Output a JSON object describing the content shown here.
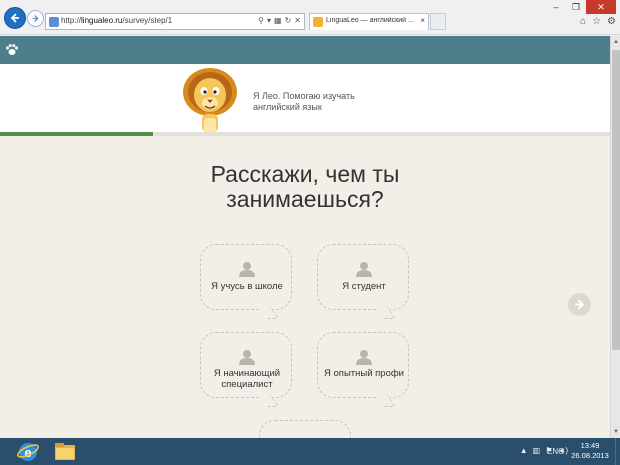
{
  "browser": {
    "url_prefix": "http://",
    "url_host": "lingualeo.ru",
    "url_path": "/survey/step/1",
    "tab_title": "LinguaLeo — английский ...",
    "tab_close": "×"
  },
  "hero": {
    "greeting": "Я Лео. Помогаю изучать английский язык"
  },
  "progress": {
    "fraction": 0.25,
    "fill_color": "#4f8f4c"
  },
  "question": "Расскажи, чем ты занимаешься?",
  "options": [
    {
      "label": "Я учусь в школе"
    },
    {
      "label": "Я студент"
    },
    {
      "label": "Я начинающий специалист"
    },
    {
      "label": "Я опытный профи"
    }
  ],
  "taskbar": {
    "language": "ENG",
    "time": "13:49",
    "date": "26.08.2013"
  },
  "colors": {
    "site_header": "#4d7e8c",
    "page_background": "#f3efe8",
    "taskbar": "#2a4f6d"
  }
}
